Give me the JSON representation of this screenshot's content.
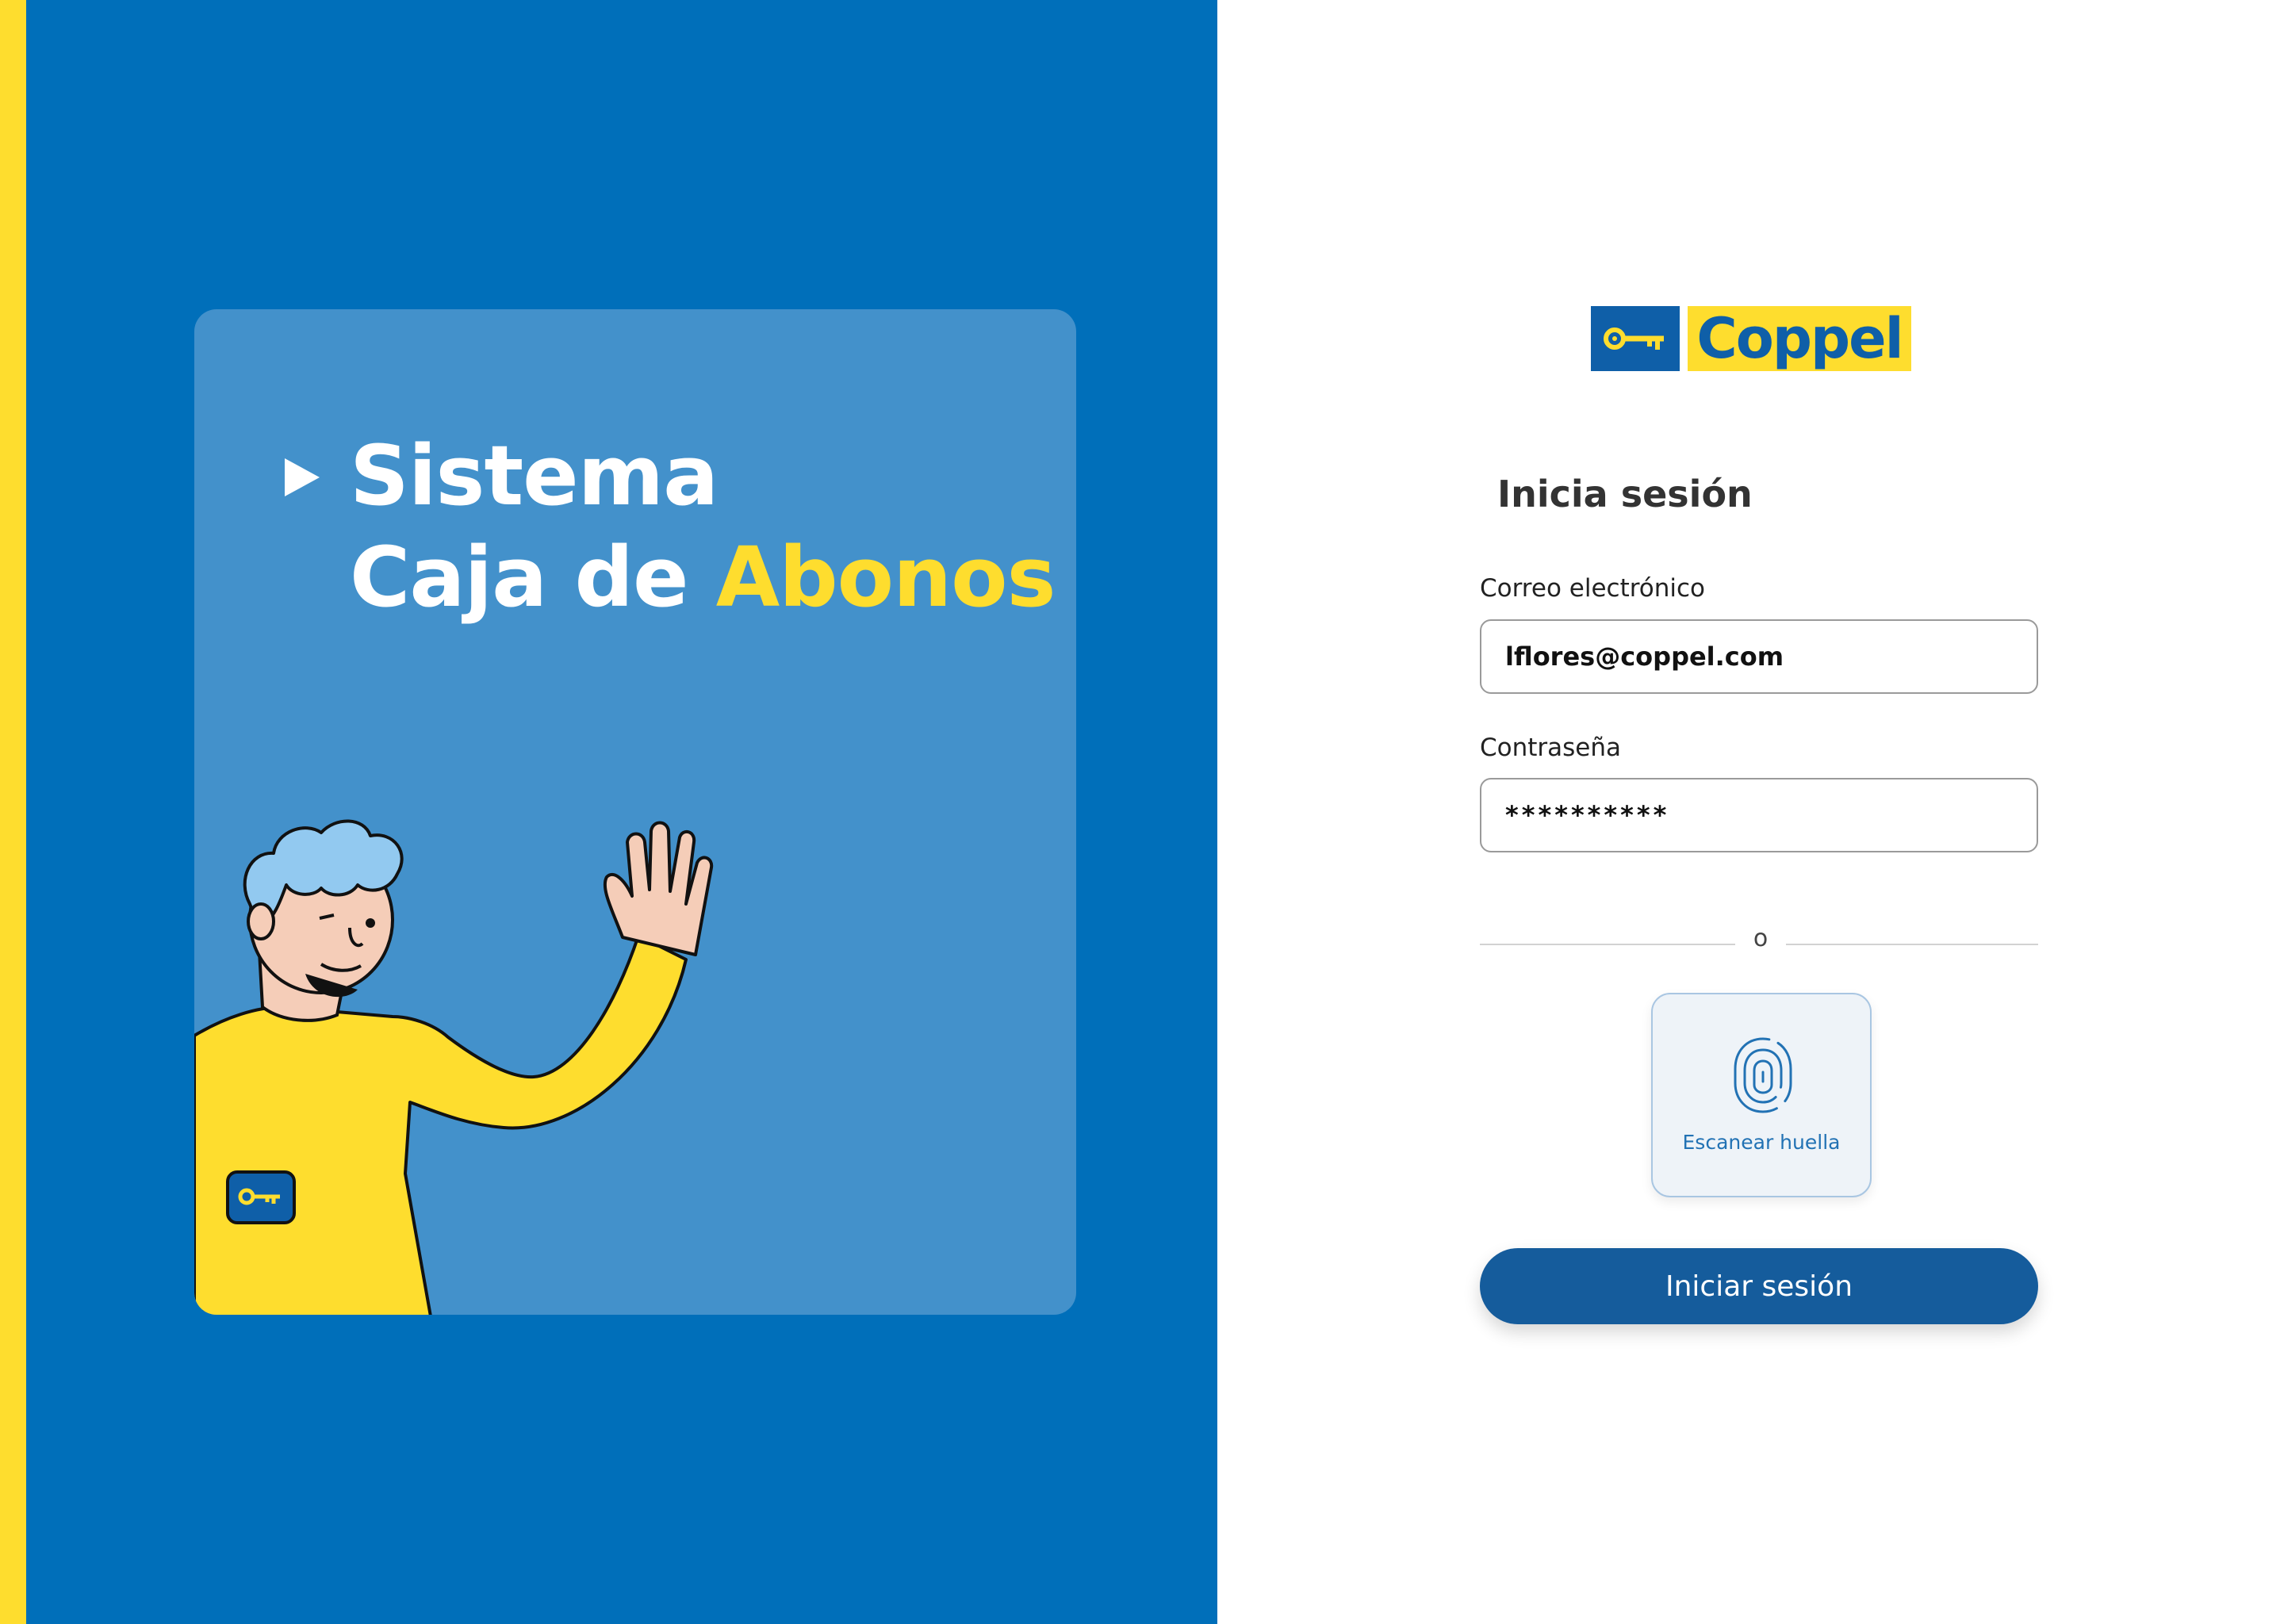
{
  "hero": {
    "title_line1": "Sistema",
    "title_line2_prefix": "Caja de",
    "title_line2_accent": "Abonos"
  },
  "brand": {
    "logo_text": "Coppel",
    "logo_mark": "key-icon"
  },
  "login": {
    "title": "Inicia sesión",
    "email_label": "Correo electrónico",
    "email_value": "lflores@coppel.com",
    "password_label": "Contraseña",
    "password_value": "**********",
    "divider_text": "o",
    "fingerprint_label": "Escanear huella",
    "submit_label": "Iniciar sesión"
  },
  "colors": {
    "brand_blue": "#006FBA",
    "card_blue": "#4391CB",
    "brand_yellow": "#FEDD2E",
    "button_blue": "#155C9C"
  }
}
